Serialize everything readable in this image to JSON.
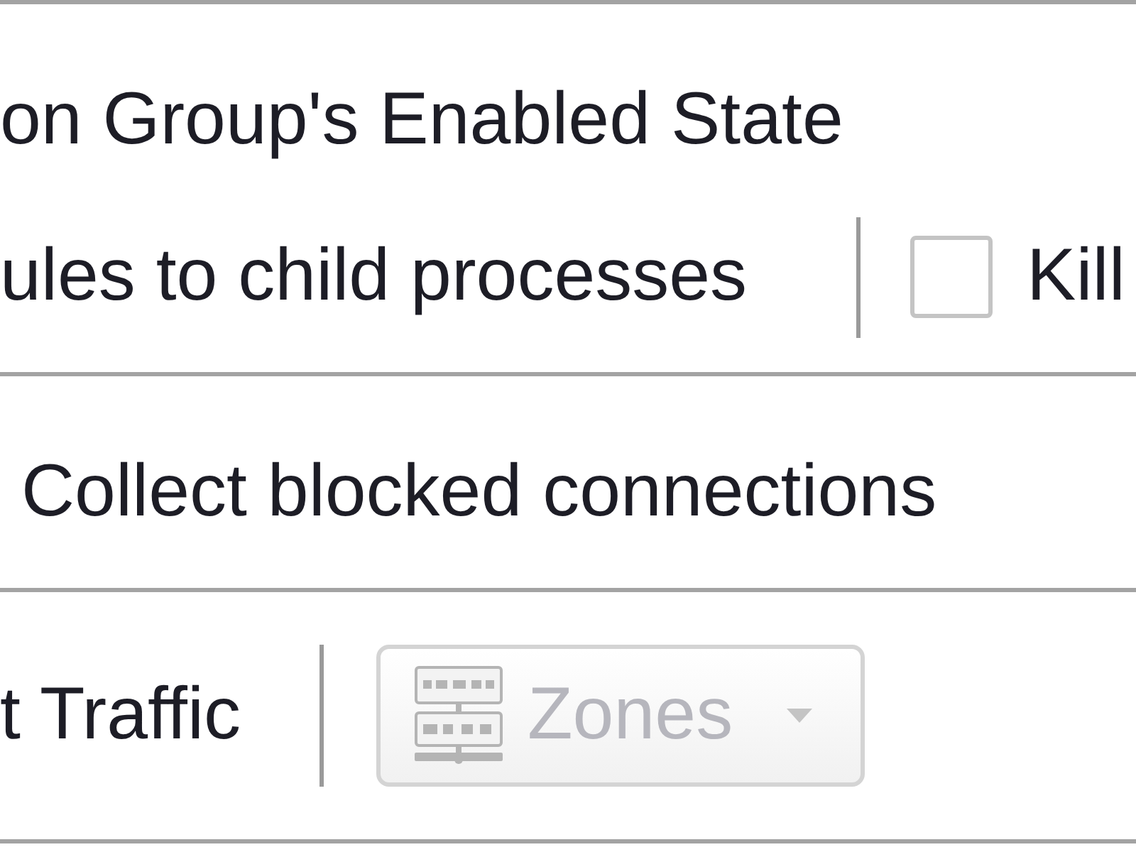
{
  "sections": [
    {
      "indent": false,
      "rows": [
        {
          "items": [
            {
              "kind": "label",
              "text": "on Group's Enabled State"
            }
          ]
        },
        {
          "items": [
            {
              "kind": "label",
              "text": "ules to child processes"
            },
            {
              "kind": "separator"
            },
            {
              "kind": "checkbox",
              "label": "Kill",
              "checked": false
            }
          ]
        }
      ]
    },
    {
      "indent": true,
      "rows": [
        {
          "items": [
            {
              "kind": "label",
              "text": "Collect blocked connections"
            }
          ]
        }
      ]
    },
    {
      "indent": false,
      "rows": [
        {
          "items": [
            {
              "kind": "label",
              "text": "t Traffic"
            },
            {
              "kind": "separator"
            },
            {
              "kind": "dropdown_button",
              "label": "Zones",
              "disabled": true
            }
          ]
        }
      ]
    }
  ]
}
